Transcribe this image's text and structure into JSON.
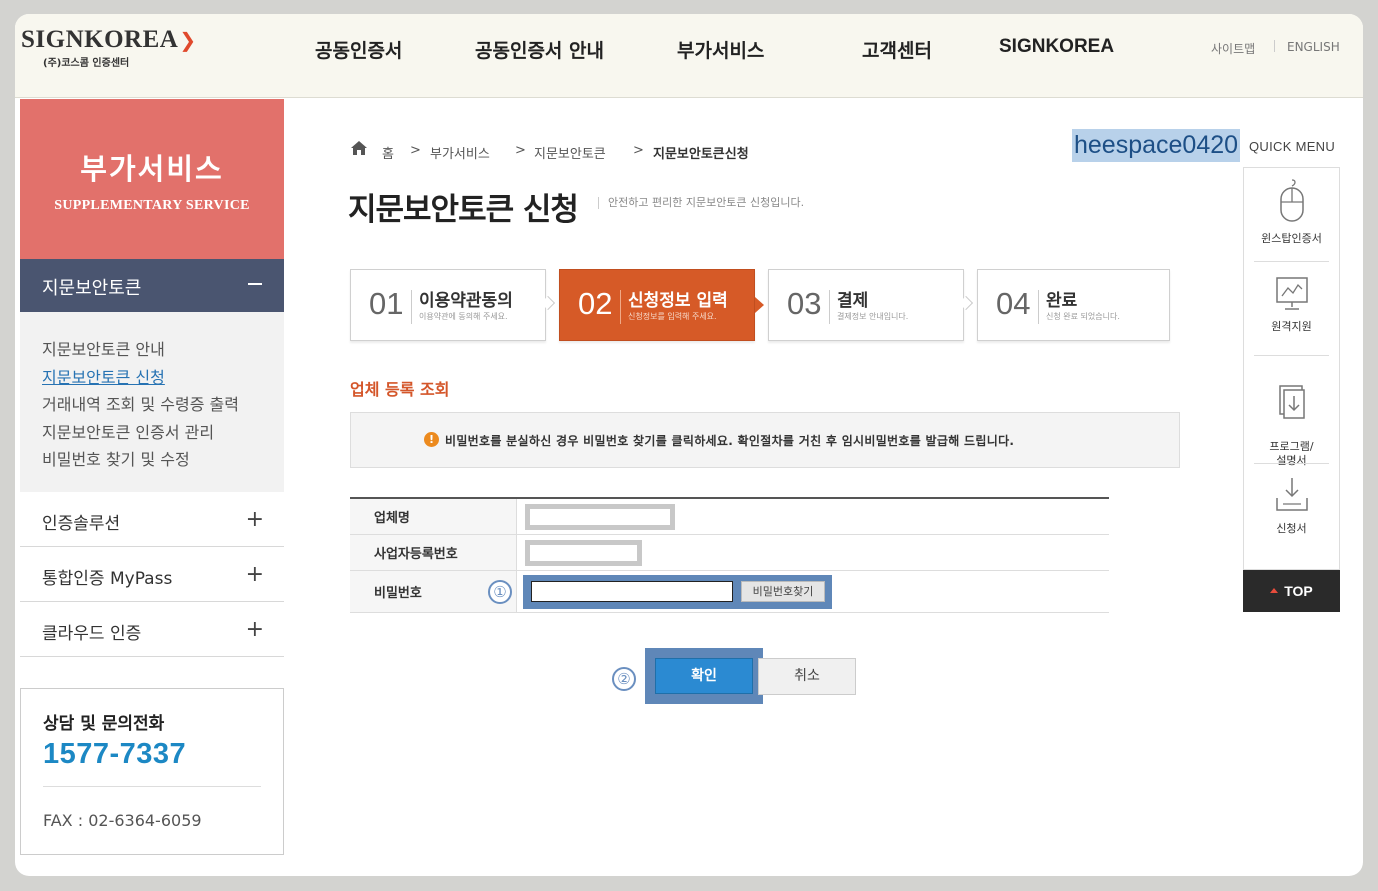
{
  "header": {
    "logo_main": "SIGNKOREA",
    "logo_sub": "(주)코스콤 인증센터",
    "nav": [
      "공동인증서",
      "공동인증서 안내",
      "부가서비스",
      "고객센터",
      "SIGNKOREA"
    ],
    "util": [
      "사이트맵",
      "ENGLISH"
    ]
  },
  "sidebar": {
    "hero_title": "부가서비스",
    "hero_sub": "SUPPLEMENTARY SERVICE",
    "active_menu": "지문보안토큰",
    "sub_items": [
      "지문보안토큰 안내",
      "지문보안토큰 신청",
      "거래내역 조회 및 수령증 출력",
      "지문보안토큰 인증서 관리",
      "비밀번호 찾기 및 수정"
    ],
    "menus": [
      "인증솔루션",
      "통합인증 MyPass",
      "클라우드 인증"
    ],
    "contact_title": "상담 및 문의전화",
    "contact_phone": "1577-7337",
    "contact_fax": "FAX : 02-6364-6059"
  },
  "breadcrumb": [
    "홈",
    ">",
    "부가서비스",
    ">",
    "지문보안토큰",
    ">",
    "지문보안토큰신청"
  ],
  "page": {
    "title": "지문보안토큰 신청",
    "desc": "안전하고 편리한 지문보안토큰 신청입니다.",
    "user_id": "heespace0420"
  },
  "steps": [
    {
      "num": "01",
      "label": "이용약관동의",
      "desc": "이용약관에 동의해 주세요."
    },
    {
      "num": "02",
      "label": "신청정보 입력",
      "desc": "신청정보를 입력해 주세요."
    },
    {
      "num": "03",
      "label": "결제",
      "desc": "결제정보 안내입니다."
    },
    {
      "num": "04",
      "label": "완료",
      "desc": "신청 완료 되었습니다."
    }
  ],
  "section_title": "업체 등록 조회",
  "notice": {
    "icon": "!",
    "text": "비밀번호를 분실하신 경우 비밀번호 찾기를 클릭하세요. 확인절차를 거친 후 임시비밀번호를 발급해 드립니다."
  },
  "form": {
    "labels": [
      "업체명",
      "사업자등록번호",
      "비밀번호"
    ],
    "company_value": "",
    "bizno_value": "",
    "password_value": "",
    "find_password": "비밀번호찾기"
  },
  "annotations": [
    "①",
    "②"
  ],
  "buttons": {
    "ok": "확인",
    "cancel": "취소"
  },
  "quick_menu": {
    "title": "QUICK MENU",
    "items": [
      "윈스탑인증서",
      "원격지원",
      "프로그램/\n설명서",
      "신청서"
    ],
    "top": "TOP"
  },
  "colors": {
    "accent": "#d65a27",
    "hero": "#e2716b",
    "nav_active": "#4a5570",
    "highlight": "#5f87b8",
    "ok_button": "#2b8ad2"
  }
}
